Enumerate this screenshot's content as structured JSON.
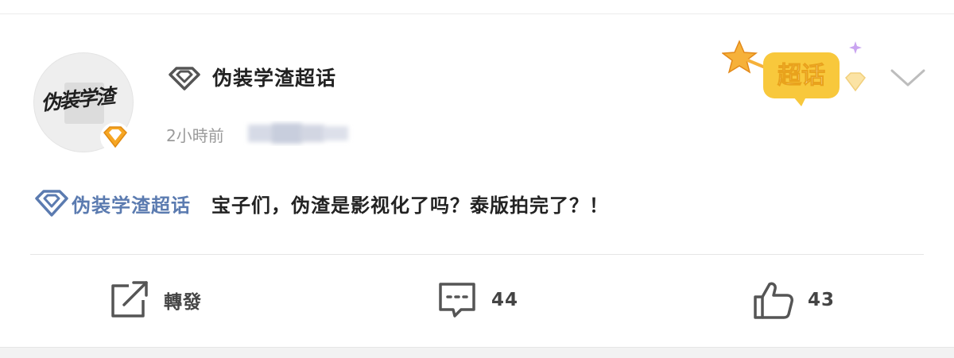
{
  "post": {
    "topic_name": "伪装学渣超话",
    "time": "2小時前",
    "tag_label": "伪装学渣超话",
    "text": "宝子们，伪渣是影视化了吗？泰版拍完了？！",
    "avatar_calligraphy": "伪装学渣",
    "sticker_label": "超话"
  },
  "actions": {
    "repost_label": "轉發",
    "comment_count": "44",
    "like_count": "43"
  },
  "colors": {
    "tag_blue": "#5b7bb0",
    "badge_orange": "#f6a623",
    "sticker_yellow": "#f8c83c"
  },
  "icons": {
    "header": "supertopic-diamond-icon",
    "badge": "verified-diamond-badge-icon",
    "menu": "chevron-down-icon",
    "repost": "repost-icon",
    "comment": "comment-icon",
    "like": "thumbs-up-icon"
  }
}
